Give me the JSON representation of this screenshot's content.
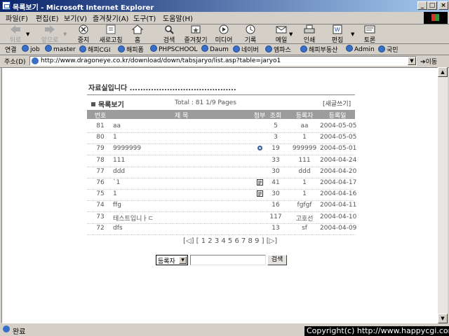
{
  "window": {
    "title": "목록보기 - Microsoft Internet Explorer"
  },
  "menu": [
    "파일(F)",
    "편집(E)",
    "보기(V)",
    "즐겨찾기(A)",
    "도구(T)",
    "도움말(H)"
  ],
  "toolbar": {
    "back": "뒤로",
    "forward": "앞으로",
    "stop": "중지",
    "refresh": "새로고침",
    "home": "홈",
    "search": "검색",
    "favorites": "즐겨찾기",
    "media": "미디어",
    "history": "기록",
    "mail": "메일",
    "print": "인쇄",
    "edit": "편집",
    "discuss": "토론"
  },
  "links": {
    "label": "연결",
    "items": [
      "job",
      "master",
      "해피CGI",
      "해피폼",
      "PHPSCHOOL",
      "Daum",
      "네이버",
      "엠파스",
      "해피부동산",
      "Admin",
      "국민"
    ]
  },
  "address": {
    "label": "주소(D)",
    "url": "http://www.dragoneye.co.kr/download/down/tabsjaryo/list.asp?table=jaryo1",
    "go": "이동"
  },
  "page": {
    "heading": "자료실입니다 ........................................",
    "section_title": "목록보기",
    "total": "Total : 81   1/9 Pages",
    "write_link": "[새글쓰기]",
    "columns": [
      "번호",
      "제 목",
      "첨부",
      "조회",
      "등록자",
      "등록일"
    ],
    "rows": [
      {
        "num": "81",
        "subject": "aa",
        "attach": "",
        "hits": "5",
        "author": "aa",
        "date": "2004-05-05"
      },
      {
        "num": "80",
        "subject": "1",
        "attach": "",
        "hits": "3",
        "author": "1",
        "date": "2004-05-05"
      },
      {
        "num": "79",
        "subject": "9999999",
        "attach": "img",
        "hits": "19",
        "author": "999999",
        "date": "2004-05-01"
      },
      {
        "num": "78",
        "subject": "111",
        "attach": "",
        "hits": "33",
        "author": "111",
        "date": "2004-04-24"
      },
      {
        "num": "77",
        "subject": "ddd",
        "attach": "",
        "hits": "30",
        "author": "ddd",
        "date": "2004-04-20"
      },
      {
        "num": "76",
        "subject": "`1",
        "attach": "doc",
        "hits": "41",
        "author": "1",
        "date": "2004-04-17"
      },
      {
        "num": "75",
        "subject": "1",
        "attach": "doc",
        "hits": "30",
        "author": "1",
        "date": "2004-04-16"
      },
      {
        "num": "74",
        "subject": "ffg",
        "attach": "",
        "hits": "16",
        "author": "fgfgf",
        "date": "2004-04-11"
      },
      {
        "num": "73",
        "subject": "테스트입니ㅏㄷ",
        "attach": "",
        "hits": "117",
        "author": "고호선",
        "date": "2004-04-10"
      },
      {
        "num": "72",
        "subject": "dfs",
        "attach": "",
        "hits": "13",
        "author": "sf",
        "date": "2004-04-09"
      }
    ],
    "pager": "[◁] [ 1 2 3 4 5 6 7 8 9 ] [▷]",
    "search": {
      "select": "등록자",
      "input": "",
      "button": "검색"
    }
  },
  "status": {
    "text": "완료",
    "copyright": "Copyright(c) http://www.happycgi.com"
  }
}
